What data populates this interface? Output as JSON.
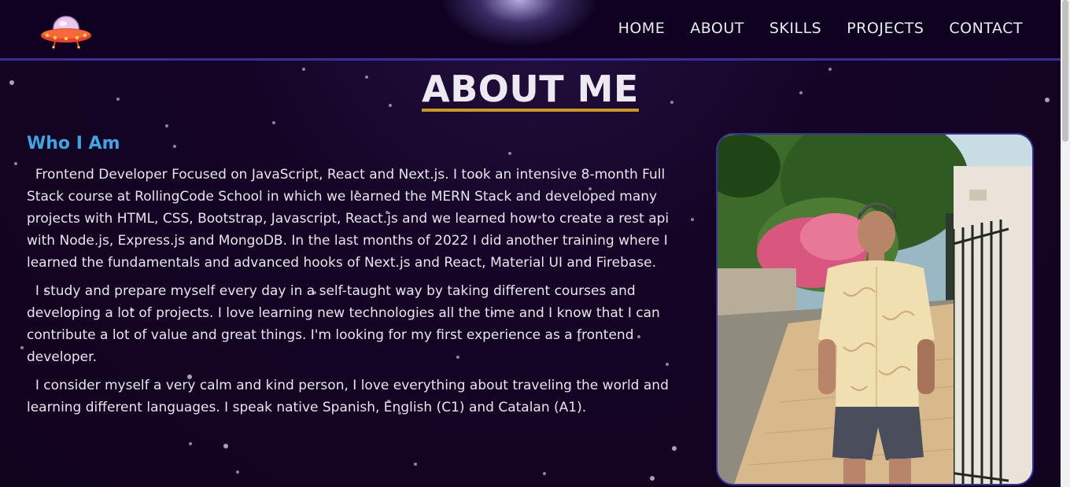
{
  "nav": {
    "links": [
      "HOME",
      "ABOUT",
      "SKILLS",
      "PROJECTS",
      "CONTACT"
    ]
  },
  "about": {
    "title": "ABOUT ME",
    "subtitle": "Who I Am",
    "paragraphs": [
      "  Frontend Developer Focused on JavaScript, React and Next.js. I took an intensive 8-month Full Stack course at RollingCode School in which we learned the MERN Stack and developed many projects with HTML, CSS, Bootstrap, Javascript, React.js and we learned how to create a rest api with Node.js, Express.js and MongoDB. In the last months of 2022 I did another training where I learned the fundamentals and advanced hooks of Next.js and React, Material UI and Firebase.",
      "  I study and prepare myself every day in a self-taught way by taking different courses and developing a lot of projects. I love learning new technologies all the time and I know that I can contribute a lot of value and great things. I'm looking for my first experience as a frontend developer.",
      "  I consider myself a very calm and kind person, I love everything about traveling the world and learning different languages. I speak native Spanish, English (C1) and Catalan (A1)."
    ]
  },
  "colors": {
    "background": "#12031f",
    "navbar": "#0f0220",
    "nav_border": "#3a2f9a",
    "title_underline": "#c99a1e",
    "subtitle": "#3aa7e6"
  },
  "icons": {
    "logo": "ufo-logo-icon"
  }
}
